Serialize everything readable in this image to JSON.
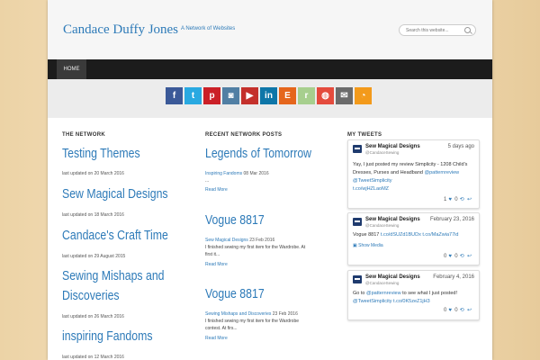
{
  "header": {
    "site_title": "Candace Duffy Jones",
    "tagline": "A Network of Websites",
    "search_placeholder": "Search this website..."
  },
  "nav": {
    "items": [
      {
        "label": "HOME"
      }
    ]
  },
  "social": [
    {
      "name": "facebook-icon",
      "glyph": "f",
      "color": "#3b5998"
    },
    {
      "name": "twitter-icon",
      "glyph": "t",
      "color": "#29a9e1"
    },
    {
      "name": "pinterest-icon",
      "glyph": "p",
      "color": "#cb2027"
    },
    {
      "name": "instagram-icon",
      "glyph": "◙",
      "color": "#517fa4"
    },
    {
      "name": "youtube-icon",
      "glyph": "▶",
      "color": "#c4302b"
    },
    {
      "name": "linkedin-icon",
      "glyph": "in",
      "color": "#0e76a8"
    },
    {
      "name": "etsy-icon",
      "glyph": "E",
      "color": "#e5661c"
    },
    {
      "name": "ravelry-icon",
      "glyph": "r",
      "color": "#a7cf8e"
    },
    {
      "name": "craftsy-icon",
      "glyph": "◍",
      "color": "#e44b3d"
    },
    {
      "name": "email-icon",
      "glyph": "✉",
      "color": "#6b6b6b"
    },
    {
      "name": "rss-icon",
      "glyph": "◔",
      "color": "#f39a1b"
    }
  ],
  "network": {
    "heading": "THE NETWORK",
    "items": [
      {
        "title": "Testing Themes",
        "updated": "last updated on 20 March 2016"
      },
      {
        "title": "Sew Magical Designs",
        "updated": "last updated on 18 March 2016"
      },
      {
        "title": "Candace's Craft Time",
        "updated": "last updated on 29 August 2015"
      },
      {
        "title": "Sewing Mishaps and",
        "title2": "Discoveries",
        "updated": "last updated on 26 March 2016"
      },
      {
        "title": "inspiring Fandoms",
        "updated": "last updated on 12 March 2016"
      }
    ]
  },
  "posts": {
    "heading": "RECENT NETWORK POSTS",
    "items": [
      {
        "title": "Legends of Tomorrow",
        "source": "Inspiring Fandoms",
        "date": "08 Mar 2016",
        "excerpt": "...",
        "more": "Read More"
      },
      {
        "title": "Vogue 8817",
        "source": "Sew Magical Designs",
        "date": "23 Feb 2016",
        "excerpt": "I finished sewing my first item for the Wardrobe. At first it...",
        "more": "Read More"
      },
      {
        "title": "Vogue 8817",
        "source": "Sewing Mishaps and Discoveries",
        "date": "23 Feb 2016",
        "excerpt": "I finished sewing my first item for the Wardrobe contest. At firs...",
        "more": "Read More"
      }
    ]
  },
  "tweets": {
    "heading": "MY TWEETS",
    "items": [
      {
        "name": "Sew Magical Designs",
        "handle": "@CandaceSewing",
        "date": "5 days ago",
        "text1": "Yay, I just posted my review Simplicity - 1208 Child's Dresses, Purses and Headband",
        "text2a": "@patternreview",
        "text2b": "@TweetSimplicity",
        "text3": "t.co/wjHZLaoMZ",
        "likes": "1",
        "retweets": "0"
      },
      {
        "name": "Sew Magical Designs",
        "handle": "@CandaceSewing",
        "date": "February 23, 2016",
        "text1": "Vogue 8817",
        "text1b": "t.co/dSUZd1BUDx t.co/MaZwia77id",
        "media": "Show Media",
        "likes": "0",
        "retweets": "0"
      },
      {
        "name": "Sew Magical Designs",
        "handle": "@CandaceSewing",
        "date": "February 4, 2016",
        "text1a": "Go to",
        "text1b": "@patternreview",
        "text1c": "to see what I just posted!",
        "text2": "@TweetSimplicity t.co/0K5zeZ1jH3",
        "likes": "0",
        "retweets": "0"
      }
    ]
  }
}
